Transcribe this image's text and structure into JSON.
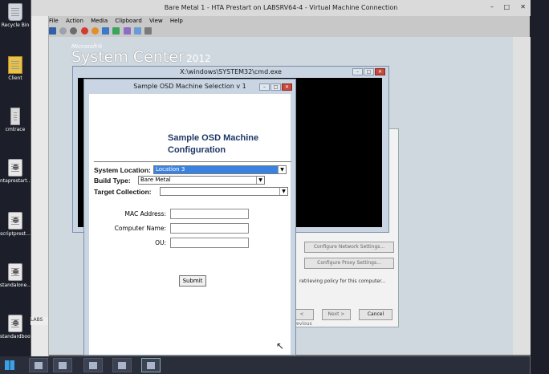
{
  "desktop": {
    "icons": [
      {
        "label": "Recycle Bin",
        "icon": "recycle-bin-icon"
      },
      {
        "label": "Client",
        "icon": "folder-icon"
      },
      {
        "label": "cmtrace",
        "icon": "server-icon"
      },
      {
        "label": "ntaprestart...",
        "icon": "gear-file-icon"
      },
      {
        "label": "scriptprest...",
        "icon": "gear-file-icon"
      },
      {
        "label": "standalone...",
        "icon": "gear-file-icon"
      },
      {
        "label": "standardboot",
        "icon": "gear-file-icon"
      }
    ]
  },
  "vm_window": {
    "title": "Bare Metal 1 - HTA Prestart on LABSRV64-4 - Virtual Machine Connection",
    "menu": [
      "File",
      "Action",
      "Media",
      "Clipboard",
      "View",
      "Help"
    ],
    "brand_microsoft": "Microsoft®",
    "brand_name": "System Center",
    "brand_year": "2012",
    "status_label": "LABS"
  },
  "cmd_window": {
    "title": "X:\\windows\\SYSTEM32\\cmd.exe"
  },
  "background_dialog": {
    "buttons": [
      "Configure Network Settings...",
      "Configure Proxy Settings...",
      "< Previous",
      "Next >",
      "Cancel"
    ],
    "status_text": "retrieving policy for this computer..."
  },
  "hta_window": {
    "title": "Sample OSD Machine Selection v 1",
    "heading_line1": "Sample OSD Machine",
    "heading_line2": "Configuration",
    "system_location_label": "System Location:",
    "system_location_value": "Location 3",
    "build_type_label": "Build Type:",
    "build_type_value": "Bare Metal",
    "target_collection_label": "Target Collection:",
    "target_collection_value": "",
    "mac_label": "MAC Address:",
    "computer_name_label": "Computer Name:",
    "ou_label": "OU:",
    "submit_label": "Submit"
  },
  "colors": {
    "heading": "#1f3864",
    "selection": "#3a82e0",
    "close_button": "#c5483b"
  }
}
